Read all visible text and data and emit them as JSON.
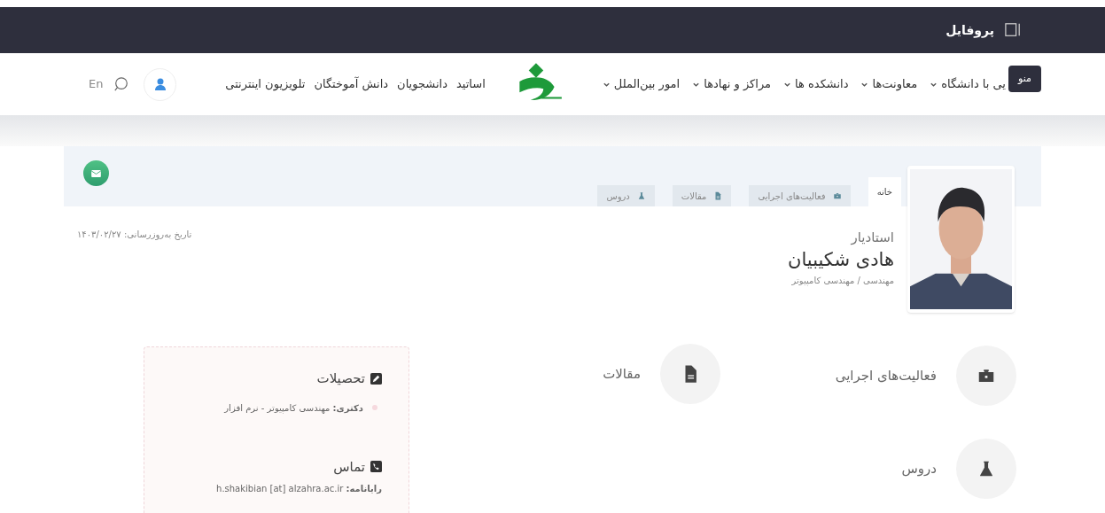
{
  "top_bar": {
    "title": "پروفایل",
    "tooltip": "منو"
  },
  "nav": {
    "menus": [
      {
        "label": "یی با دانشگاه"
      },
      {
        "label": "معاونت‌ها"
      },
      {
        "label": "دانشکده ها"
      },
      {
        "label": "مراکز و نهادها"
      },
      {
        "label": "امور بین‌الملل"
      }
    ],
    "links": [
      "اساتید",
      "دانشجویان",
      "دانش آموختگان",
      "تلویزیون اینترنتی"
    ],
    "language": "En"
  },
  "profile": {
    "tabs": [
      {
        "label": "خانه",
        "selected": true
      },
      {
        "label": "فعالیت‌های اجرایی",
        "selected": false
      },
      {
        "label": "مقالات",
        "selected": false
      },
      {
        "label": "دروس",
        "selected": false
      }
    ],
    "rank": "استادیار",
    "name": "هادی شکیبیان",
    "department": "مهندسی / مهندسی کامپیوتر",
    "updated": "تاریخ به‌روزرسانی: ۱۴۰۳/۰۲/۲۷"
  },
  "sections": [
    {
      "label": "فعالیت‌های اجرایی"
    },
    {
      "label": "مقالات"
    },
    {
      "label": "دروس"
    }
  ],
  "education": {
    "title": "تحصیلات",
    "items": [
      {
        "text": "**دکتری:** مهندسی کامپیوتر - نرم افزار"
      }
    ]
  },
  "contact": {
    "title": "تماس",
    "email": "**رایانامه:** h.shakibian [at] alzahra.ac.ir"
  }
}
